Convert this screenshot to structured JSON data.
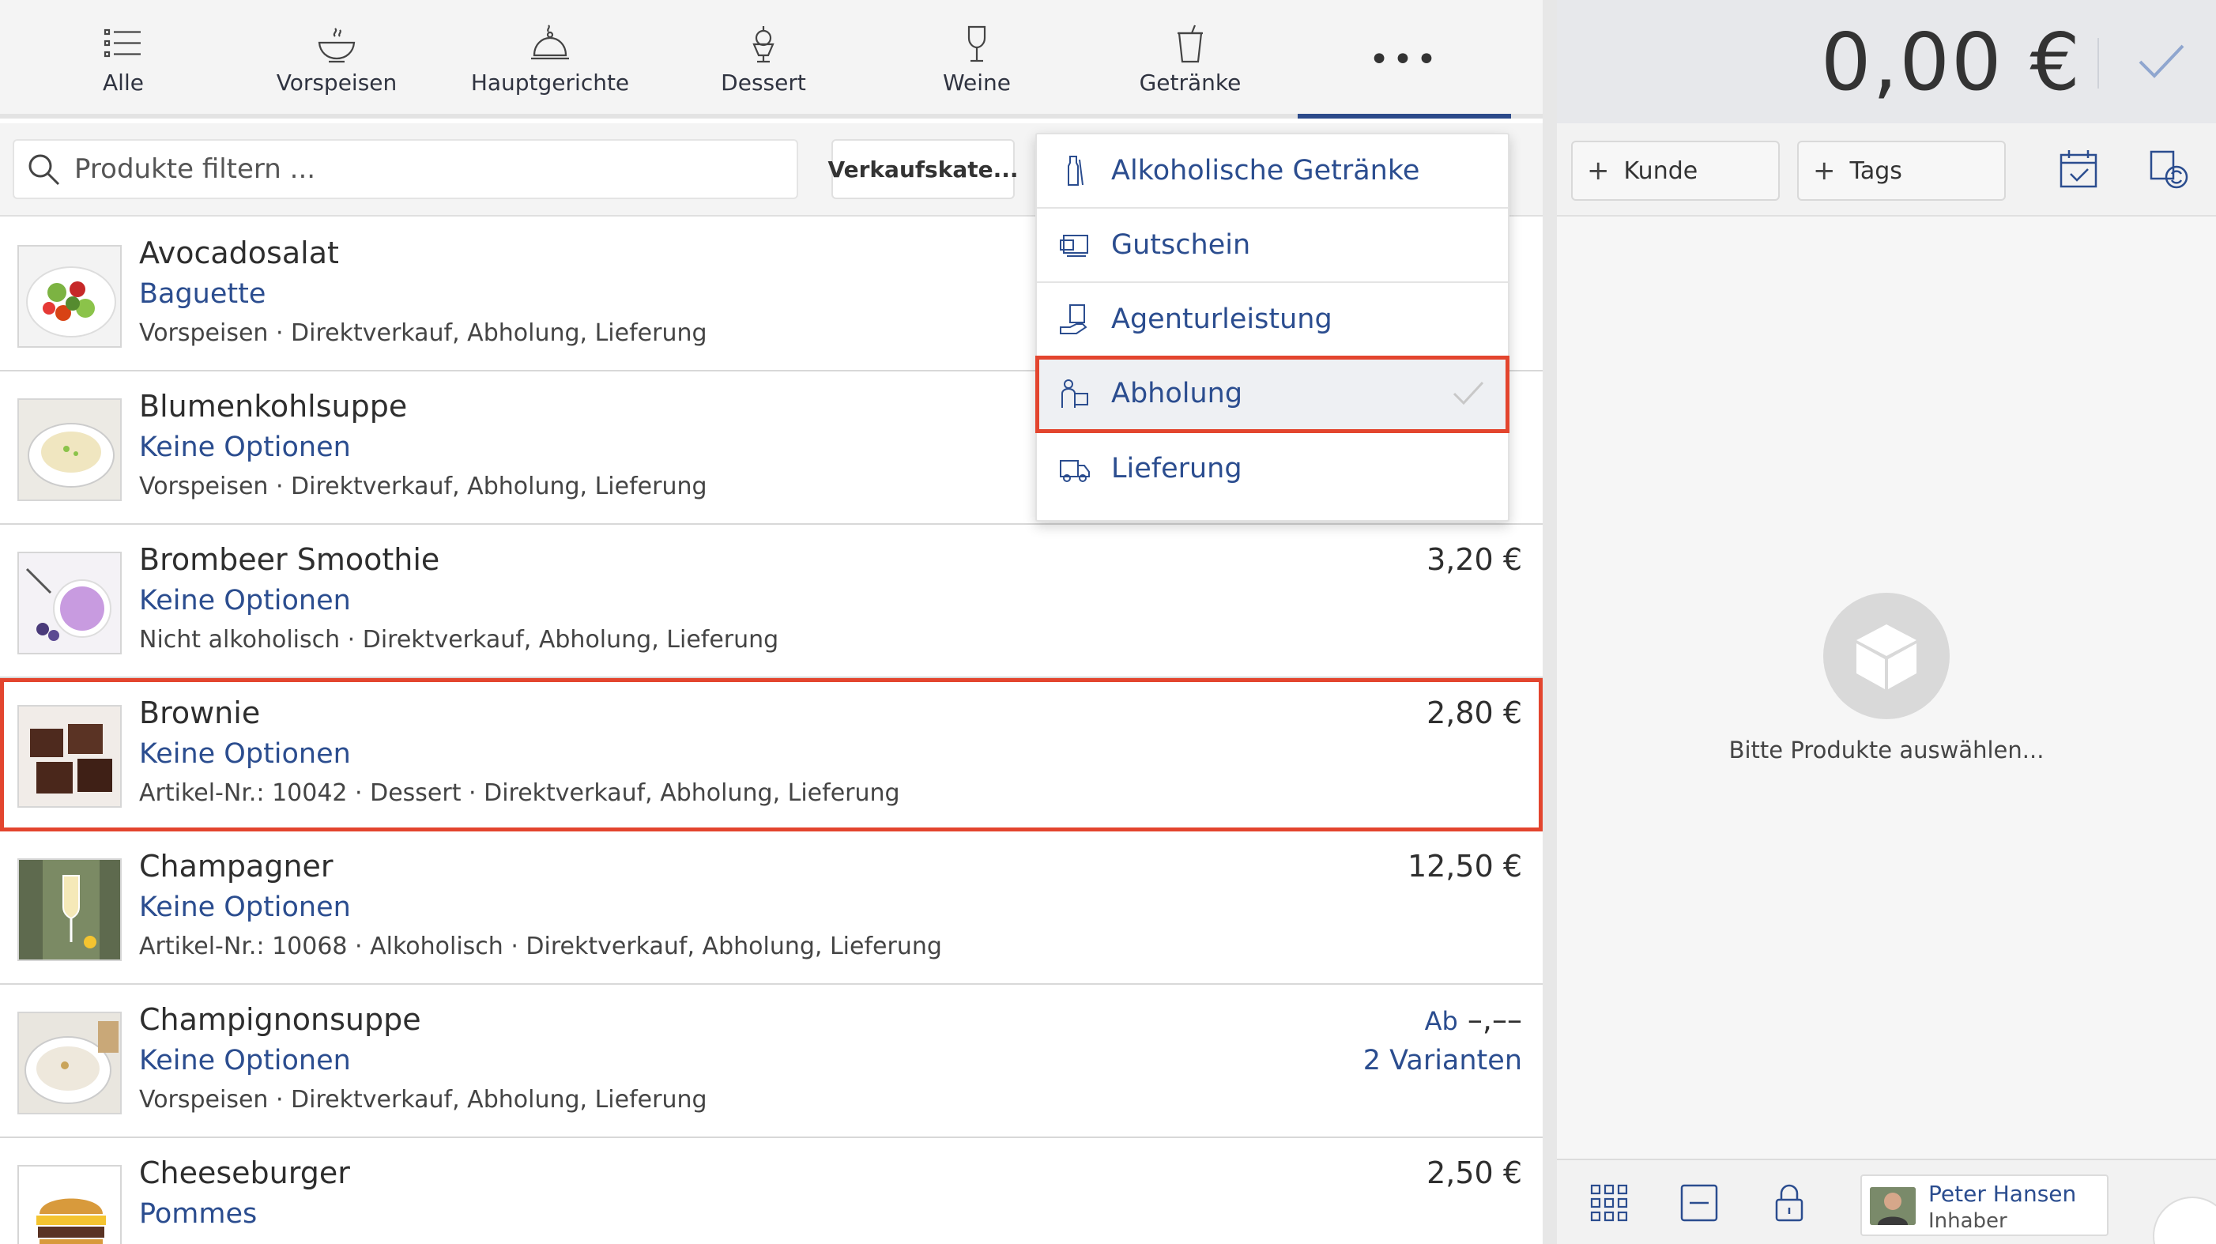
{
  "tabs": [
    {
      "label": "Alle",
      "icon": "list-icon"
    },
    {
      "label": "Vorspeisen",
      "icon": "bowl-icon"
    },
    {
      "label": "Hauptgerichte",
      "icon": "cloche-icon"
    },
    {
      "label": "Dessert",
      "icon": "ice-cream-icon"
    },
    {
      "label": "Weine",
      "icon": "wine-glass-icon"
    },
    {
      "label": "Getränke",
      "icon": "cup-icon"
    }
  ],
  "more_label": "•••",
  "search": {
    "placeholder": "Produkte filtern ..."
  },
  "sales_category_button": "Verkaufskate...",
  "products": [
    {
      "name": "Avocadosalat",
      "option": "Baguette",
      "meta": "Vorspeisen · Direktverkauf, Abholung, Lieferung",
      "price": "",
      "price_extra": ""
    },
    {
      "name": "Blumenkohlsuppe",
      "option": "Keine Optionen",
      "meta": "Vorspeisen · Direktverkauf, Abholung, Lieferung",
      "price": "",
      "price_extra": ""
    },
    {
      "name": "Brombeer Smoothie",
      "option": "Keine Optionen",
      "meta": "Nicht alkoholisch · Direktverkauf, Abholung, Lieferung",
      "price": "3,20 €",
      "price_extra": ""
    },
    {
      "name": "Brownie",
      "option": "Keine Optionen",
      "meta": "Artikel-Nr.: 10042 · Dessert · Direktverkauf, Abholung, Lieferung",
      "price": "2,80 €",
      "price_extra": ""
    },
    {
      "name": "Champagner",
      "option": "Keine Optionen",
      "meta": "Artikel-Nr.: 10068 · Alkoholisch · Direktverkauf, Abholung, Lieferung",
      "price": "12,50 €",
      "price_extra": ""
    },
    {
      "name": "Champignonsuppe",
      "option": "Keine Optionen",
      "meta": "Vorspeisen · Direktverkauf, Abholung, Lieferung",
      "price_prefix": "Ab",
      "price": "–,––",
      "price_extra": "2 Varianten"
    },
    {
      "name": "Cheeseburger",
      "option": "Pommes",
      "meta": "",
      "price": "2,50 €",
      "price_extra": ""
    }
  ],
  "dropdown": {
    "items": [
      {
        "label": "Alkoholische Getränke",
        "icon": "bottle-icon",
        "selected": false
      },
      {
        "label": "Gutschein",
        "icon": "voucher-icon",
        "selected": false
      },
      {
        "label": "Agenturleistung",
        "icon": "agency-hand-icon",
        "selected": false
      },
      {
        "label": "Abholung",
        "icon": "pickup-icon",
        "selected": true
      },
      {
        "label": "Lieferung",
        "icon": "delivery-truck-icon",
        "selected": false
      }
    ]
  },
  "cart": {
    "total": "0,00 €",
    "customer_button": "Kunde",
    "tags_button": "Tags",
    "empty_message": "Bitte Produkte auswählen..."
  },
  "user": {
    "name": "Peter Hansen",
    "role": "Inhaber"
  },
  "colors": {
    "accent": "#2b4d8f",
    "highlight": "#e3452e"
  }
}
